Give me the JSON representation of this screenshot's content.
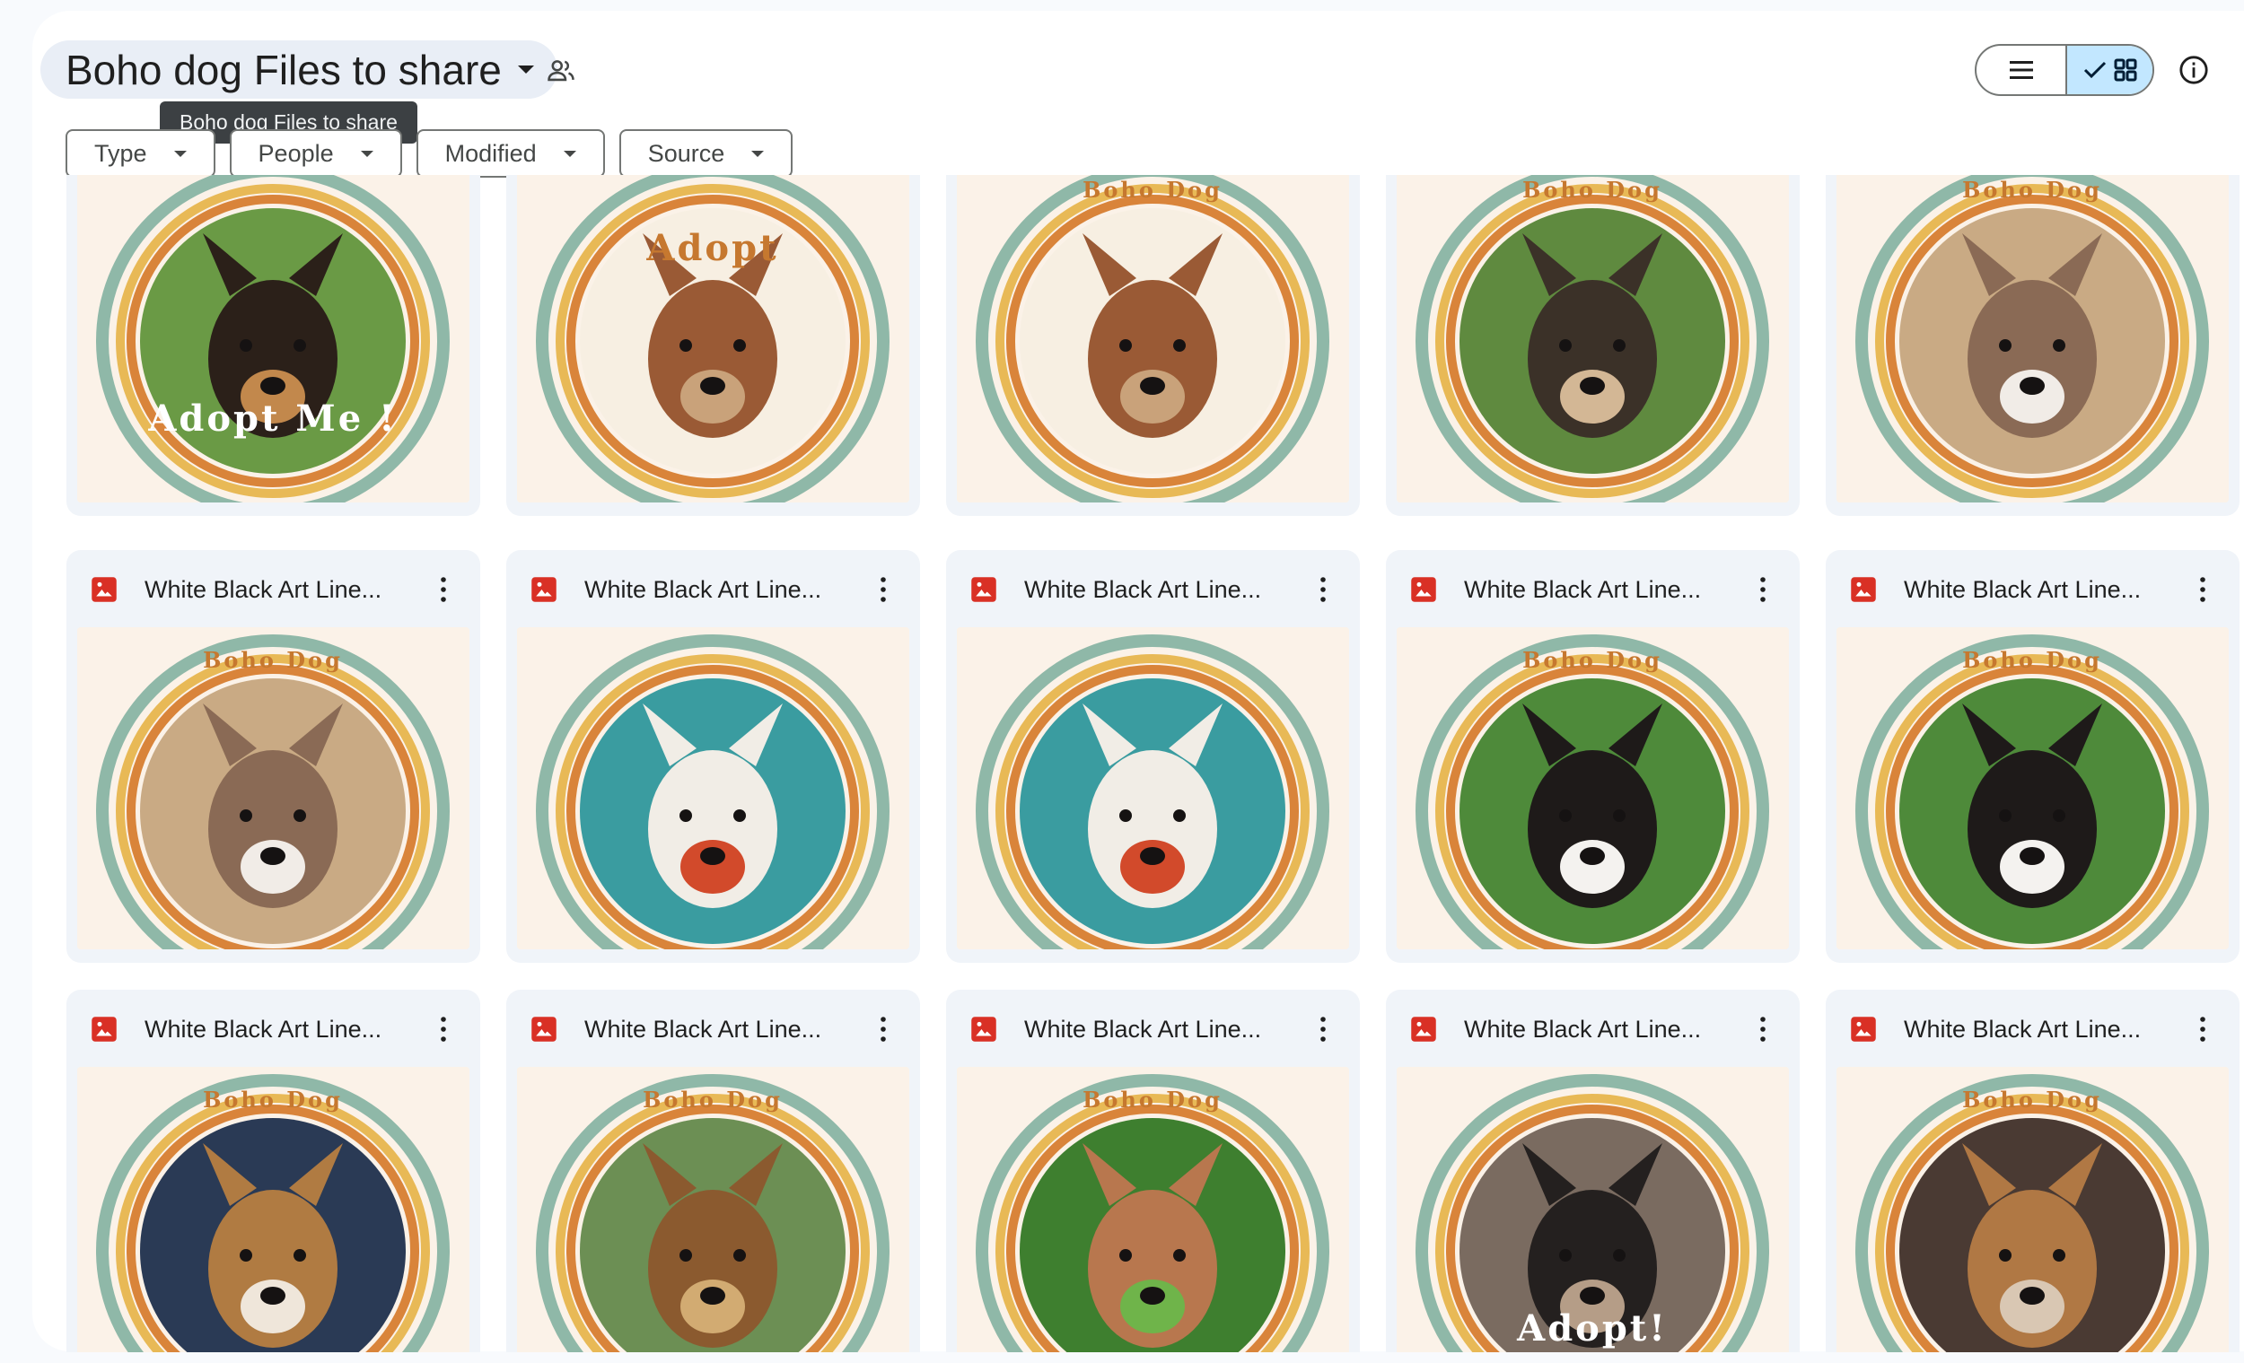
{
  "folder": {
    "title": "Boho dog Files to share",
    "tooltip": "Boho dog Files to share"
  },
  "filters": [
    {
      "label": "Type"
    },
    {
      "label": "People"
    },
    {
      "label": "Modified"
    },
    {
      "label": "Source"
    }
  ],
  "view": {
    "selected": "grid"
  },
  "file_type_icon": "image-file-icon",
  "top_row_thumbs": [
    {
      "overlay_text": "Adopt Me !",
      "photo": "black-tan-dog"
    },
    {
      "overlay_text": "Adopt",
      "photo": "dog-cowboy-hat"
    },
    {
      "overlay_text": "Boho Dog",
      "photo": "dog-cowboy-hat"
    },
    {
      "overlay_text": "Boho Dog",
      "photo": "shepherd-on-grass"
    },
    {
      "overlay_text": "Boho Dog",
      "photo": "pitbull-tongue-out"
    }
  ],
  "row2_files": [
    {
      "name": "White Black Art Line...",
      "overlay_text": "Boho Dog",
      "photo": "pitbull-tongue-out"
    },
    {
      "name": "White Black Art Line...",
      "overlay_text": "",
      "photo": "white-puppy-on-blanket"
    },
    {
      "name": "White Black Art Line...",
      "overlay_text": "",
      "photo": "white-puppy-on-blanket"
    },
    {
      "name": "White Black Art Line...",
      "overlay_text": "Boho Dog",
      "photo": "black-white-puppy"
    },
    {
      "name": "White Black Art Line...",
      "overlay_text": "Boho Dog",
      "photo": "black-white-puppy"
    }
  ],
  "row3_files": [
    {
      "name": "White Black Art Line...",
      "overlay_text": "Boho Dog",
      "photo": "shepherd-puppy-lying"
    },
    {
      "name": "White Black Art Line...",
      "overlay_text": "Boho Dog",
      "photo": "fluffy-brown-dog"
    },
    {
      "name": "White Black Art Line...",
      "overlay_text": "Boho Dog",
      "photo": "red-puppy-in-clover"
    },
    {
      "name": "White Black Art Line...",
      "overlay_text": "Adopt!",
      "photo": "dark-dog-on-couch"
    },
    {
      "name": "White Black Art Line...",
      "overlay_text": "Boho Dog",
      "photo": "shepherd-on-bed"
    }
  ],
  "colors": {
    "ring_teal": "#8fb8a8",
    "ring_yellow": "#e8b956",
    "ring_orange": "#d9843a",
    "thumb_bg": "#fbf2e8",
    "card_bg": "#f0f4f9",
    "image_icon_red": "#d93025",
    "view_selected": "#c2e7ff"
  }
}
